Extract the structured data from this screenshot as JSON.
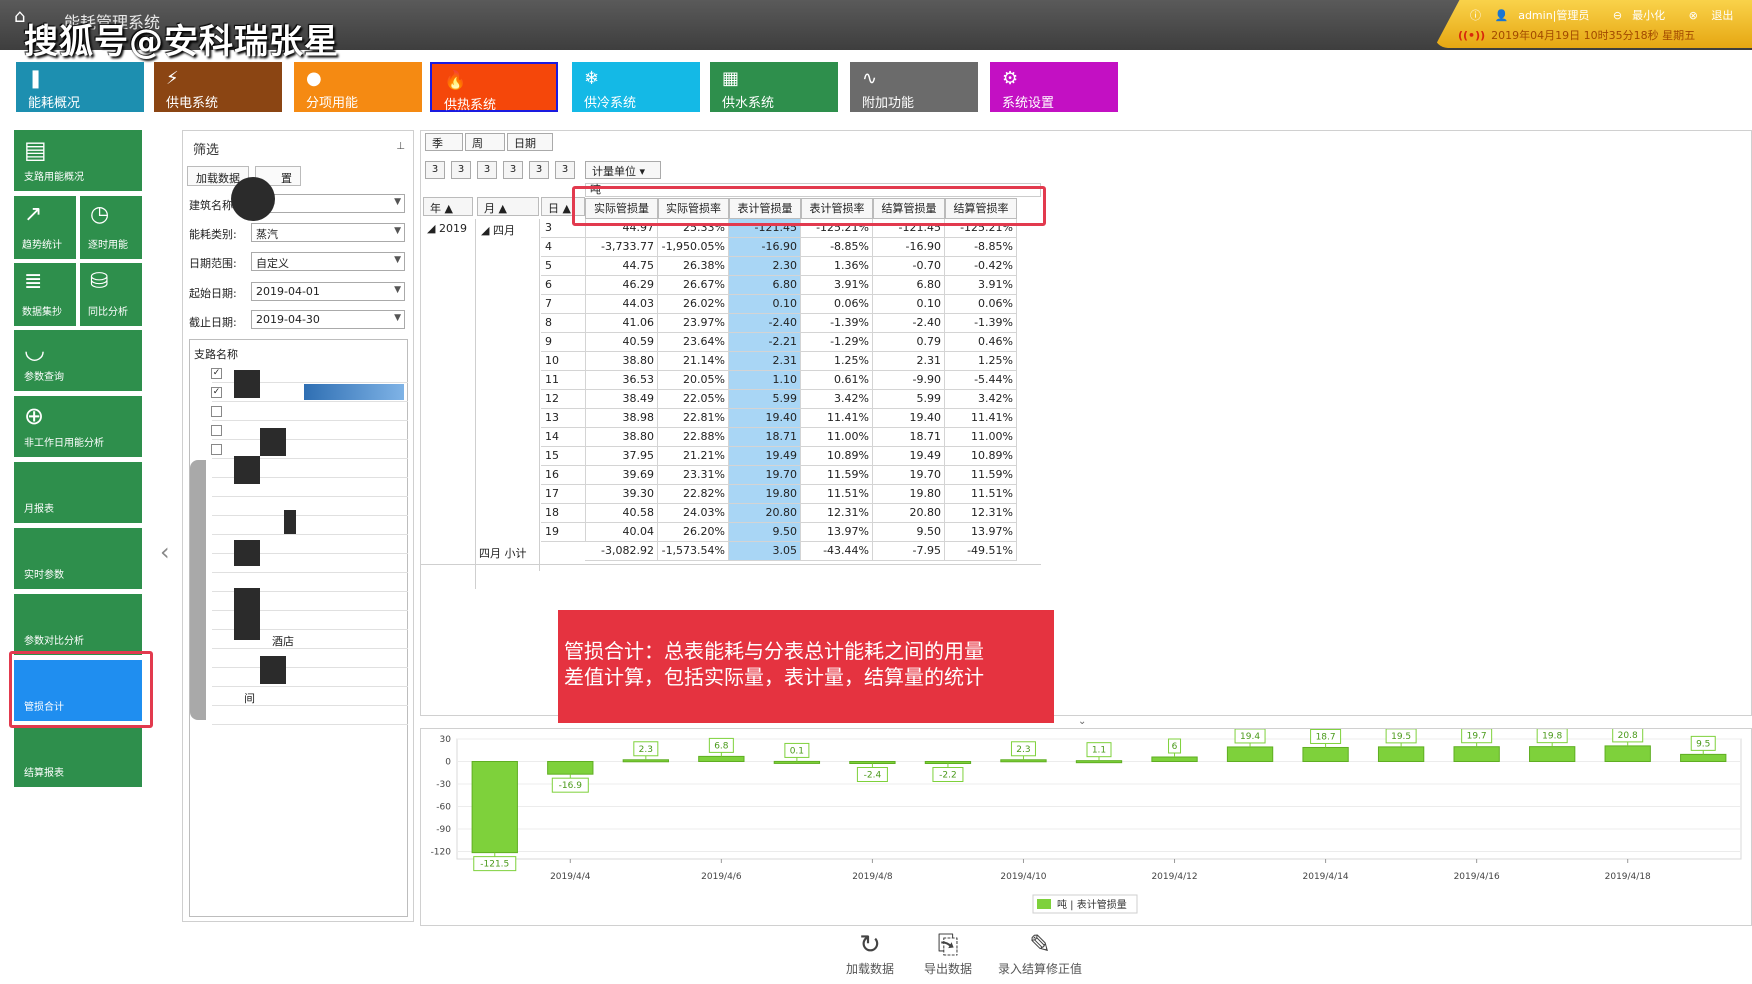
{
  "header": {
    "app_title": "能耗管理系统",
    "watermark": "搜狐号@安科瑞张星",
    "user": "admin|管理员",
    "minimize": "最小化",
    "logout": "退出",
    "datetime": "2019年04月19日 10时35分18秒 星期五"
  },
  "nav": [
    {
      "label": "能耗概况",
      "icon": "bar-user-icon",
      "color": "#1d8fb0"
    },
    {
      "label": "供电系统",
      "icon": "power-chart-icon",
      "color": "#8b4513"
    },
    {
      "label": "分项用能",
      "icon": "user-icon",
      "color": "#f58a12"
    },
    {
      "label": "供热系统",
      "icon": "flame-icon",
      "color": "#f5470a"
    },
    {
      "label": "供冷系统",
      "icon": "snowflake-icon",
      "color": "#14b9e6"
    },
    {
      "label": "供水系统",
      "icon": "grid-icon",
      "color": "#2e8f4c"
    },
    {
      "label": "附加功能",
      "icon": "pulse-icon",
      "color": "#6b6b6b"
    },
    {
      "label": "系统设置",
      "icon": "gear-icon",
      "color": "#c310c3"
    }
  ],
  "sidebar": [
    {
      "label": "支路用能概况",
      "icon": "book-icon"
    },
    {
      "label": "趋势统计",
      "icon": "trend-icon"
    },
    {
      "label": "逐时用能",
      "icon": "clock-icon"
    },
    {
      "label": "数据集抄",
      "icon": "document-icon"
    },
    {
      "label": "同比分析",
      "icon": "database-icon"
    },
    {
      "label": "参数查询",
      "icon": "satellite-icon"
    },
    {
      "label": "非工作日用能分析",
      "icon": "crosshair-icon"
    },
    {
      "label": "月报表",
      "icon": ""
    },
    {
      "label": "实时参数",
      "icon": ""
    },
    {
      "label": "参数对比分析",
      "icon": ""
    },
    {
      "label": "管损合计",
      "icon": ""
    },
    {
      "label": "结算报表",
      "icon": ""
    }
  ],
  "filter": {
    "title": "筛选",
    "tab_load": "加载数据",
    "tab_settings": "置",
    "building_label": "建筑名称:",
    "energy_label": "能耗类别:",
    "energy_value": "蒸汽",
    "range_label": "日期范围:",
    "range_value": "自定义",
    "start_label": "起始日期:",
    "start_value": "2019-04-01",
    "end_label": "截止日期:",
    "end_value": "2019-04-30",
    "list_header": "支路名称",
    "branch_hotel": "酒店",
    "branch_room": "间"
  },
  "pivot": {
    "buttons": [
      "季",
      "周",
      "日期"
    ],
    "small_buttons": [
      "3",
      "3",
      "3",
      "3",
      "3",
      "3"
    ],
    "unit_button": "计量单位",
    "unit": "吨",
    "row_headers": [
      "年",
      "月",
      "日"
    ],
    "year": "2019",
    "month": "四月",
    "subtotal_label": "四月 小计",
    "columns": [
      "实际管损量",
      "实际管损率",
      "表计管损量",
      "表计管损率",
      "结算管损量",
      "结算管损率"
    ],
    "rows": [
      {
        "day": "3",
        "vals": [
          "44.97",
          "25.33%",
          "-121.45",
          "-125.21%",
          "-121.45",
          "-125.21%"
        ]
      },
      {
        "day": "4",
        "vals": [
          "-3,733.77",
          "-1,950.05%",
          "-16.90",
          "-8.85%",
          "-16.90",
          "-8.85%"
        ]
      },
      {
        "day": "5",
        "vals": [
          "44.75",
          "26.38%",
          "2.30",
          "1.36%",
          "-0.70",
          "-0.42%"
        ]
      },
      {
        "day": "6",
        "vals": [
          "46.29",
          "26.67%",
          "6.80",
          "3.91%",
          "6.80",
          "3.91%"
        ]
      },
      {
        "day": "7",
        "vals": [
          "44.03",
          "26.02%",
          "0.10",
          "0.06%",
          "0.10",
          "0.06%"
        ]
      },
      {
        "day": "8",
        "vals": [
          "41.06",
          "23.97%",
          "-2.40",
          "-1.39%",
          "-2.40",
          "-1.39%"
        ]
      },
      {
        "day": "9",
        "vals": [
          "40.59",
          "23.64%",
          "-2.21",
          "-1.29%",
          "0.79",
          "0.46%"
        ]
      },
      {
        "day": "10",
        "vals": [
          "38.80",
          "21.14%",
          "2.31",
          "1.25%",
          "2.31",
          "1.25%"
        ]
      },
      {
        "day": "11",
        "vals": [
          "36.53",
          "20.05%",
          "1.10",
          "0.61%",
          "-9.90",
          "-5.44%"
        ]
      },
      {
        "day": "12",
        "vals": [
          "38.49",
          "22.05%",
          "5.99",
          "3.42%",
          "5.99",
          "3.42%"
        ]
      },
      {
        "day": "13",
        "vals": [
          "38.98",
          "22.81%",
          "19.40",
          "11.41%",
          "19.40",
          "11.41%"
        ]
      },
      {
        "day": "14",
        "vals": [
          "38.80",
          "22.88%",
          "18.71",
          "11.00%",
          "18.71",
          "11.00%"
        ]
      },
      {
        "day": "15",
        "vals": [
          "37.95",
          "21.21%",
          "19.49",
          "10.89%",
          "19.49",
          "10.89%"
        ]
      },
      {
        "day": "16",
        "vals": [
          "39.69",
          "23.31%",
          "19.70",
          "11.59%",
          "19.70",
          "11.59%"
        ]
      },
      {
        "day": "17",
        "vals": [
          "39.30",
          "22.82%",
          "19.80",
          "11.51%",
          "19.80",
          "11.51%"
        ]
      },
      {
        "day": "18",
        "vals": [
          "40.58",
          "24.03%",
          "20.80",
          "12.31%",
          "20.80",
          "12.31%"
        ]
      },
      {
        "day": "19",
        "vals": [
          "40.04",
          "26.20%",
          "9.50",
          "13.97%",
          "9.50",
          "13.97%"
        ]
      }
    ],
    "subtotal": [
      "-3,082.92",
      "-1,573.54%",
      "3.05",
      "-43.44%",
      "-7.95",
      "-49.51%"
    ]
  },
  "callout": {
    "line1": "管损合计：总表能耗与分表总计能耗之间的用量",
    "line2": "差值计算，包括实际量，表计量，结算量的统计"
  },
  "chart_data": {
    "type": "bar",
    "categories": [
      "2019/4/3",
      "2019/4/4",
      "2019/4/5",
      "2019/4/6",
      "2019/4/7",
      "2019/4/8",
      "2019/4/9",
      "2019/4/10",
      "2019/4/11",
      "2019/4/12",
      "2019/4/13",
      "2019/4/14",
      "2019/4/15",
      "2019/4/16",
      "2019/4/17",
      "2019/4/18",
      "2019/4/19"
    ],
    "tick_labels": [
      "2019/4/4",
      "2019/4/6",
      "2019/4/8",
      "2019/4/10",
      "2019/4/12",
      "2019/4/14",
      "2019/4/16",
      "2019/4/18"
    ],
    "series": [
      {
        "name": "吨 | 表计管损量",
        "values": [
          -121.5,
          -16.9,
          2.3,
          6.8,
          0.1,
          -2.4,
          -2.2,
          2.3,
          1.1,
          6.0,
          19.4,
          18.7,
          19.5,
          19.7,
          19.8,
          20.8,
          9.5
        ]
      }
    ],
    "yticks": [
      30,
      0,
      -30,
      -60,
      -90,
      -120
    ],
    "ylim": [
      -130,
      30
    ],
    "bar_color": "#7ed13b",
    "legend_position": "bottom"
  },
  "toolbar": {
    "load": "加载数据",
    "export": "导出数据",
    "entry": "录入结算修正值"
  }
}
